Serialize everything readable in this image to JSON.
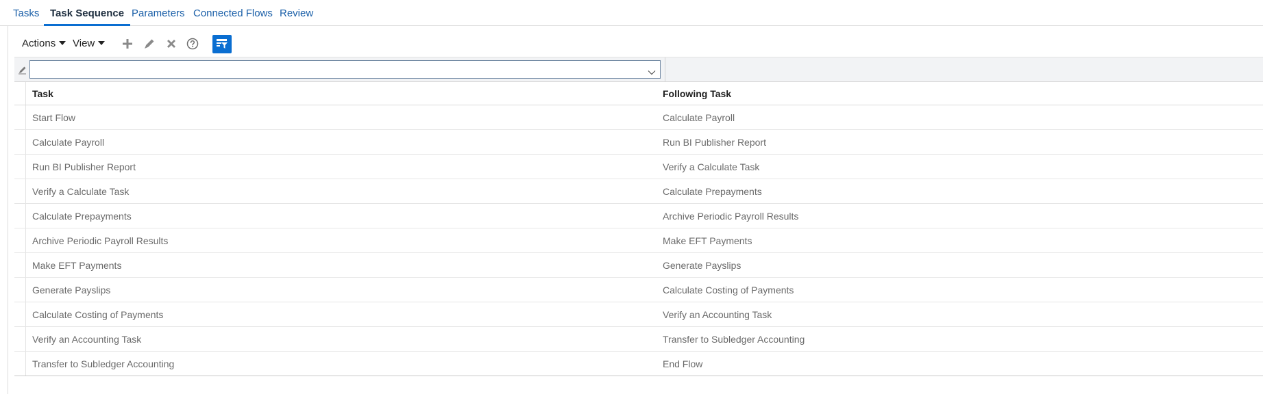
{
  "tabs": [
    {
      "label": "Tasks",
      "active": false
    },
    {
      "label": "Task Sequence",
      "active": true
    },
    {
      "label": "Parameters",
      "active": false
    },
    {
      "label": "Connected Flows",
      "active": false
    },
    {
      "label": "Review",
      "active": false
    }
  ],
  "toolbar": {
    "actions_label": "Actions",
    "view_label": "View",
    "icons": [
      "add-icon",
      "edit-icon",
      "delete-icon",
      "help-icon",
      "query-filter-icon"
    ],
    "accent_color": "#0a6ed1"
  },
  "filter": {
    "selected_value": ""
  },
  "table": {
    "columns": [
      "Task",
      "Following Task"
    ],
    "rows": [
      [
        "Start Flow",
        "Calculate Payroll"
      ],
      [
        "Calculate Payroll",
        "Run BI Publisher Report"
      ],
      [
        "Run BI Publisher Report",
        "Verify a Calculate Task"
      ],
      [
        "Verify a Calculate Task",
        "Calculate Prepayments"
      ],
      [
        "Calculate Prepayments",
        "Archive Periodic Payroll Results"
      ],
      [
        "Archive Periodic Payroll Results",
        "Make EFT Payments"
      ],
      [
        "Make EFT Payments",
        "Generate Payslips"
      ],
      [
        "Generate Payslips",
        "Calculate Costing of Payments"
      ],
      [
        "Calculate Costing of Payments",
        "Verify an Accounting Task"
      ],
      [
        "Verify an Accounting Task",
        "Transfer to Subledger Accounting"
      ],
      [
        "Transfer to Subledger Accounting",
        "End Flow"
      ]
    ]
  }
}
